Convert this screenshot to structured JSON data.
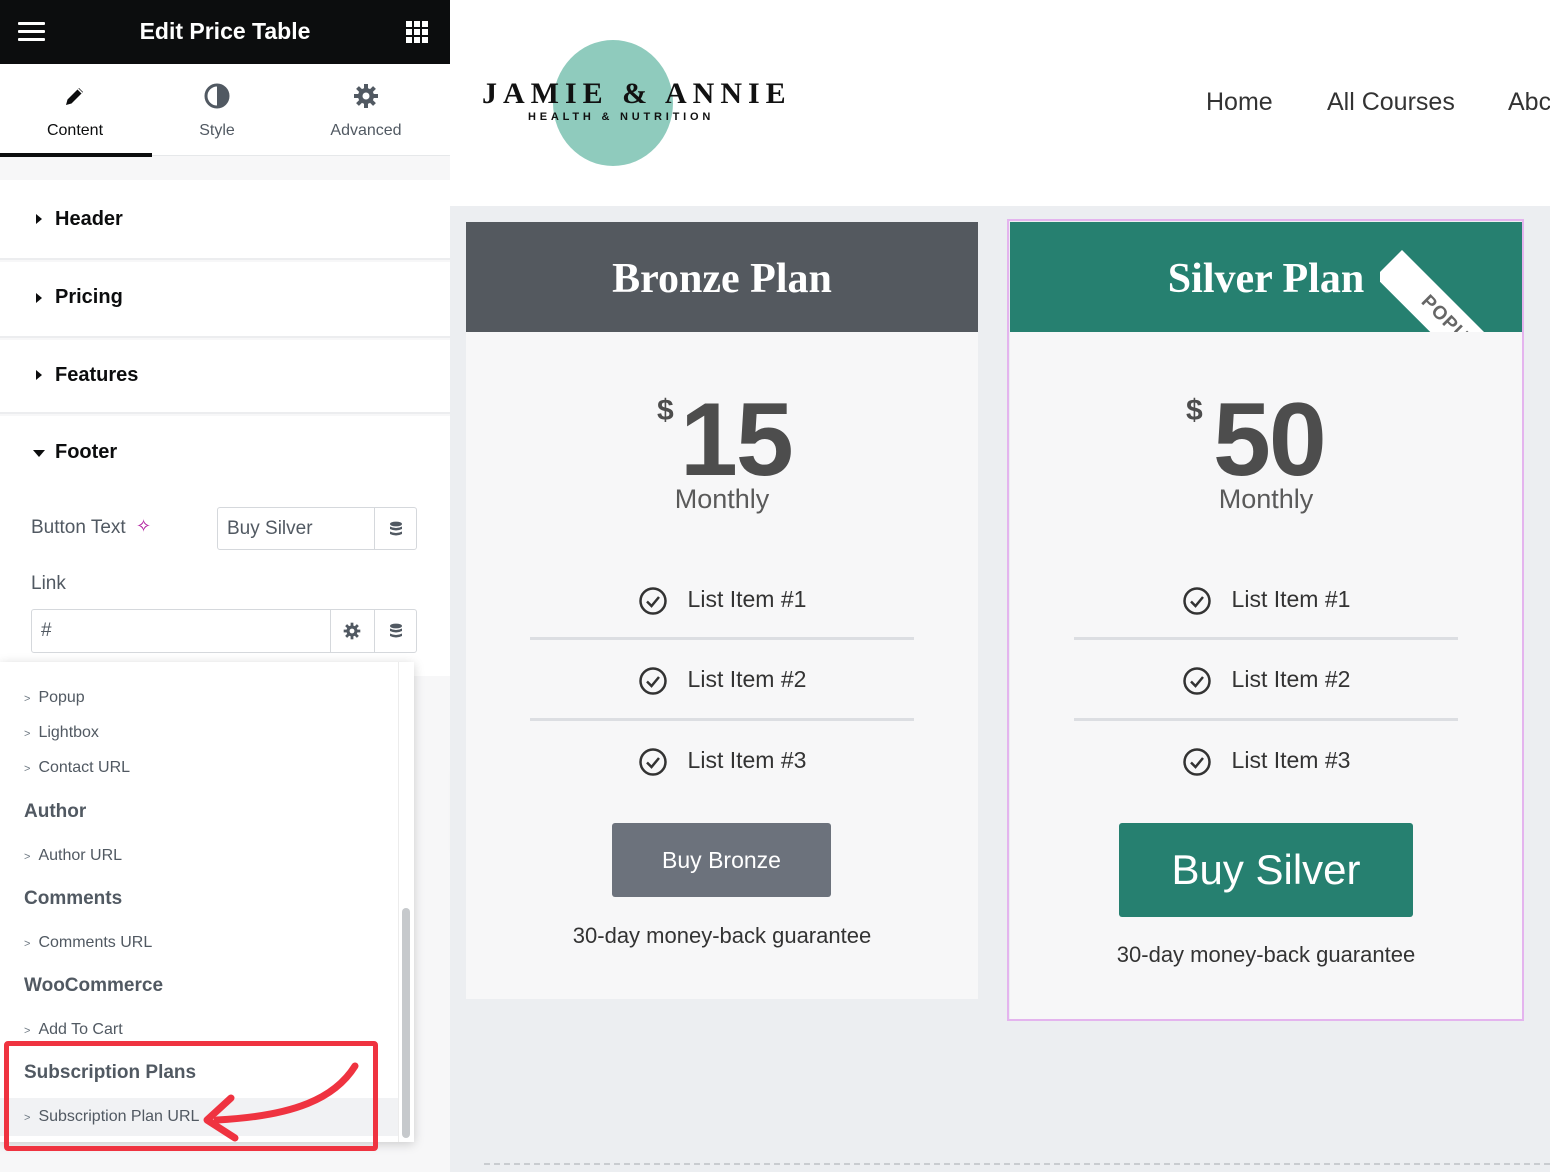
{
  "editor": {
    "title": "Edit Price Table",
    "tabs": [
      {
        "label": "Content",
        "icon": "pencil-icon"
      },
      {
        "label": "Style",
        "icon": "contrast-icon"
      },
      {
        "label": "Advanced",
        "icon": "gear-icon"
      }
    ],
    "sections": [
      "Header",
      "Pricing",
      "Features",
      "Footer"
    ],
    "footer": {
      "button_text_label": "Button Text",
      "button_text_value": "Buy Silver",
      "link_label": "Link",
      "link_value": "#"
    },
    "dropdown": {
      "items_top": [
        "Popup",
        "Lightbox",
        "Contact URL"
      ],
      "author_head": "Author",
      "author_items": [
        "Author URL"
      ],
      "comments_head": "Comments",
      "comments_items": [
        "Comments URL"
      ],
      "woo_head": "WooCommerce",
      "woo_items": [
        "Add To Cart"
      ],
      "subs_head": "Subscription Plans",
      "subs_items": [
        "Subscription Plan URL"
      ]
    },
    "colors": {
      "highlight": "#ef3340",
      "dark": "#0c0d0e"
    }
  },
  "site": {
    "logo_name": "JAMIE & ANNIE",
    "logo_tagline": "HEALTH & NUTRITION",
    "nav": [
      "Home",
      "All Courses",
      "Abc"
    ]
  },
  "plans": [
    {
      "title": "Bronze Plan",
      "currency": "$",
      "amount": "15",
      "period": "Monthly",
      "features": [
        "List Item #1",
        "List Item #2",
        "List Item #3"
      ],
      "button": "Buy Bronze",
      "guarantee": "30-day money-back guarantee",
      "header_color": "#54595f",
      "button_color": "#6c727c"
    },
    {
      "title": "Silver Plan",
      "currency": "$",
      "amount": "50",
      "period": "Monthly",
      "features": [
        "List Item #1",
        "List Item #2",
        "List Item #3"
      ],
      "button": "Buy Silver",
      "guarantee": "30-day money-back guarantee",
      "ribbon": "POPULAR",
      "header_color": "#268070",
      "button_color": "#268070"
    }
  ]
}
